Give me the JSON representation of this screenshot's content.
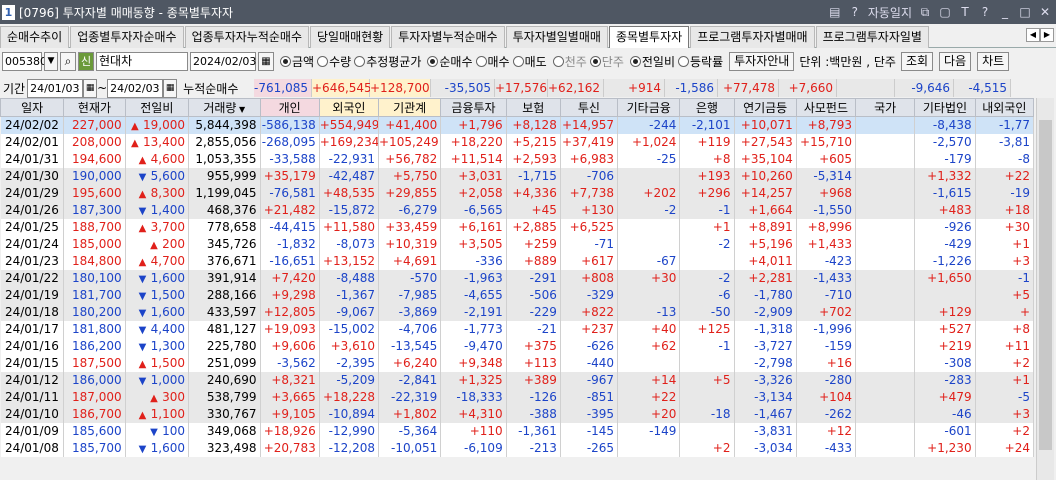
{
  "window": {
    "number": "1",
    "title": "[0796] 투자자별 매매동향 - 종목별투자자",
    "auto_save": "자동일지"
  },
  "tabs": [
    "순매수추이",
    "업종별투자자순매수",
    "업종투자자누적순매수",
    "당일매매현황",
    "투자자별누적순매수",
    "투자자별일별매매",
    "종목별투자자",
    "프로그램투자자별매매",
    "프로그램투자자일별"
  ],
  "active_tab": 6,
  "controls": {
    "code": "005380",
    "stock_name": "현대차",
    "date": "2024/02/03",
    "radio1": [
      {
        "label": "금액",
        "on": true
      },
      {
        "label": "수량",
        "on": false
      },
      {
        "label": "추정평균가",
        "on": false
      }
    ],
    "radio2": [
      {
        "label": "순매수",
        "on": true
      },
      {
        "label": "매수",
        "on": false
      },
      {
        "label": "매도",
        "on": false
      }
    ],
    "radio3": [
      {
        "label": "천주",
        "on": false
      },
      {
        "label": "단주",
        "on": true
      }
    ],
    "radio4": [
      {
        "label": "전일비",
        "on": true
      },
      {
        "label": "등락률",
        "on": false
      }
    ],
    "info_button": "투자자안내",
    "unit": "단위 :백만원 , 단주",
    "search": "조회",
    "next": "다음",
    "chart": "차트"
  },
  "period": {
    "label": "기간",
    "from": "24/01/03",
    "sep": "~",
    "to": "24/02/03",
    "cum_label": "누적순매수"
  },
  "cum": [
    "-761,085",
    "+646,545",
    "+128,700",
    "-35,505",
    "+17,576",
    "+62,162",
    "+914",
    "-1,586",
    "+77,478",
    "+7,660",
    "",
    "-9,646",
    "-4,515"
  ],
  "headers": [
    "일자",
    "현재가",
    "전일비",
    "거래량",
    "개인",
    "외국인",
    "기관계",
    "금융투자",
    "보험",
    "투신",
    "기타금융",
    "은행",
    "연기금등",
    "사모펀드",
    "국가",
    "기타법인",
    "내외국인"
  ],
  "rows": [
    [
      "24/02/02",
      "227,000",
      "u",
      "19,000",
      "5,844,398",
      "-586,138",
      "+554,949",
      "+41,400",
      "+1,796",
      "+8,128",
      "+14,957",
      "-244",
      "-2,101",
      "+10,071",
      "+8,793",
      "",
      "-8,438",
      "-1,77"
    ],
    [
      "24/02/01",
      "208,000",
      "u",
      "13,400",
      "2,855,056",
      "-268,095",
      "+169,234",
      "+105,249",
      "+18,220",
      "+5,215",
      "+37,419",
      "+1,024",
      "+119",
      "+27,543",
      "+15,710",
      "",
      "-2,570",
      "-3,81"
    ],
    [
      "24/01/31",
      "194,600",
      "u",
      "4,600",
      "1,053,355",
      "-33,588",
      "-22,931",
      "+56,782",
      "+11,514",
      "+2,593",
      "+6,983",
      "-25",
      "+8",
      "+35,104",
      "+605",
      "",
      "-179",
      "-8"
    ],
    [
      "24/01/30",
      "190,000",
      "d",
      "5,600",
      "955,999",
      "+35,179",
      "-42,487",
      "+5,750",
      "+3,031",
      "-1,715",
      "-706",
      "",
      "+193",
      "+10,260",
      "-5,314",
      "",
      "+1,332",
      "+22"
    ],
    [
      "24/01/29",
      "195,600",
      "u",
      "8,300",
      "1,199,045",
      "-76,581",
      "+48,535",
      "+29,855",
      "+2,058",
      "+4,336",
      "+7,738",
      "+202",
      "+296",
      "+14,257",
      "+968",
      "",
      "-1,615",
      "-19"
    ],
    [
      "24/01/26",
      "187,300",
      "d",
      "1,400",
      "468,376",
      "+21,482",
      "-15,872",
      "-6,279",
      "-6,565",
      "+45",
      "+130",
      "-2",
      "-1",
      "+1,664",
      "-1,550",
      "",
      "+483",
      "+18"
    ],
    [
      "24/01/25",
      "188,700",
      "u",
      "3,700",
      "778,658",
      "-44,415",
      "+11,580",
      "+33,459",
      "+6,161",
      "+2,885",
      "+6,525",
      "",
      "+1",
      "+8,891",
      "+8,996",
      "",
      "-926",
      "+30"
    ],
    [
      "24/01/24",
      "185,000",
      "u",
      "200",
      "345,726",
      "-1,832",
      "-8,073",
      "+10,319",
      "+3,505",
      "+259",
      "-71",
      "",
      "-2",
      "+5,196",
      "+1,433",
      "",
      "-429",
      "+1"
    ],
    [
      "24/01/23",
      "184,800",
      "u",
      "4,700",
      "376,671",
      "-16,651",
      "+13,152",
      "+4,691",
      "-336",
      "+889",
      "+617",
      "-67",
      "",
      "+4,011",
      "-423",
      "",
      "-1,226",
      "+3"
    ],
    [
      "24/01/22",
      "180,100",
      "d",
      "1,600",
      "391,914",
      "+7,420",
      "-8,488",
      "-570",
      "-1,963",
      "-291",
      "+808",
      "+30",
      "-2",
      "+2,281",
      "-1,433",
      "",
      "+1,650",
      "-1"
    ],
    [
      "24/01/19",
      "181,700",
      "d",
      "1,500",
      "288,166",
      "+9,298",
      "-1,367",
      "-7,985",
      "-4,655",
      "-506",
      "-329",
      "",
      "-6",
      "-1,780",
      "-710",
      "",
      "",
      "+5"
    ],
    [
      "24/01/18",
      "180,200",
      "d",
      "1,600",
      "433,597",
      "+12,805",
      "-9,067",
      "-3,869",
      "-2,191",
      "-229",
      "+822",
      "-13",
      "-50",
      "-2,909",
      "+702",
      "",
      "+129",
      "+"
    ],
    [
      "24/01/17",
      "181,800",
      "d",
      "4,400",
      "481,127",
      "+19,093",
      "-15,002",
      "-4,706",
      "-1,773",
      "-21",
      "+237",
      "+40",
      "+125",
      "-1,318",
      "-1,996",
      "",
      "+527",
      "+8"
    ],
    [
      "24/01/16",
      "186,200",
      "d",
      "1,300",
      "225,780",
      "+9,606",
      "+3,610",
      "-13,545",
      "-9,470",
      "+375",
      "-626",
      "+62",
      "-1",
      "-3,727",
      "-159",
      "",
      "+219",
      "+11"
    ],
    [
      "24/01/15",
      "187,500",
      "u",
      "1,500",
      "251,099",
      "-3,562",
      "-2,395",
      "+6,240",
      "+9,348",
      "+113",
      "-440",
      "",
      "",
      "-2,798",
      "+16",
      "",
      "-308",
      "+2"
    ],
    [
      "24/01/12",
      "186,000",
      "d",
      "1,000",
      "240,690",
      "+8,321",
      "-5,209",
      "-2,841",
      "+1,325",
      "+389",
      "-967",
      "+14",
      "+5",
      "-3,326",
      "-280",
      "",
      "-283",
      "+1"
    ],
    [
      "24/01/11",
      "187,000",
      "u",
      "300",
      "538,799",
      "+3,665",
      "+18,228",
      "-22,319",
      "-18,333",
      "-126",
      "-851",
      "+22",
      "",
      "-3,134",
      "+104",
      "",
      "+479",
      "-5"
    ],
    [
      "24/01/10",
      "186,700",
      "u",
      "1,100",
      "330,767",
      "+9,105",
      "-10,894",
      "+1,802",
      "+4,310",
      "-388",
      "-395",
      "+20",
      "-18",
      "-1,467",
      "-262",
      "",
      "-46",
      "+3"
    ],
    [
      "24/01/09",
      "185,600",
      "d",
      "100",
      "349,068",
      "+18,926",
      "-12,990",
      "-5,364",
      "+110",
      "-1,361",
      "-145",
      "-149",
      "",
      "-3,831",
      "+12",
      "",
      "-601",
      "+2"
    ],
    [
      "24/01/08",
      "185,700",
      "d",
      "1,600",
      "323,498",
      "+20,783",
      "-12,208",
      "-10,051",
      "-6,109",
      "-213",
      "-265",
      "",
      "+2",
      "-3,034",
      "-433",
      "",
      "+1,230",
      "+24"
    ]
  ]
}
